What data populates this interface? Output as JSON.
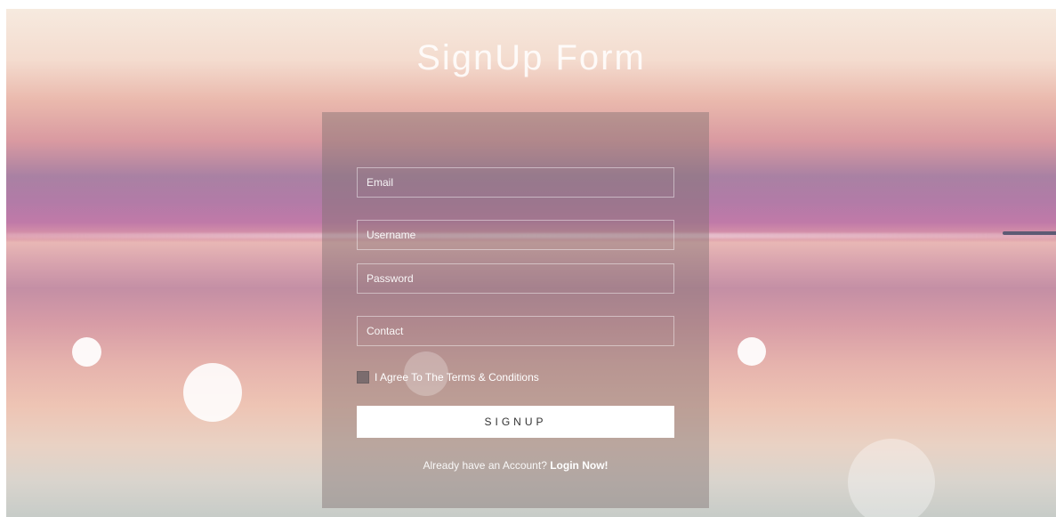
{
  "page": {
    "title": "SignUp Form"
  },
  "form": {
    "email_placeholder": "Email",
    "username_placeholder": "Username",
    "password_placeholder": "Password",
    "contact_placeholder": "Contact",
    "agree_label": "I Agree To The Terms & Conditions",
    "signup_label": "SIGNUP",
    "login_prompt": "Already have an Account?",
    "login_link": "Login Now!"
  },
  "icons": {
    "checkbox": "checkbox-icon"
  },
  "colors": {
    "panel_overlay": "#807070",
    "button_bg": "#ffffff",
    "button_text": "#333333",
    "text_light": "#ffffff"
  }
}
